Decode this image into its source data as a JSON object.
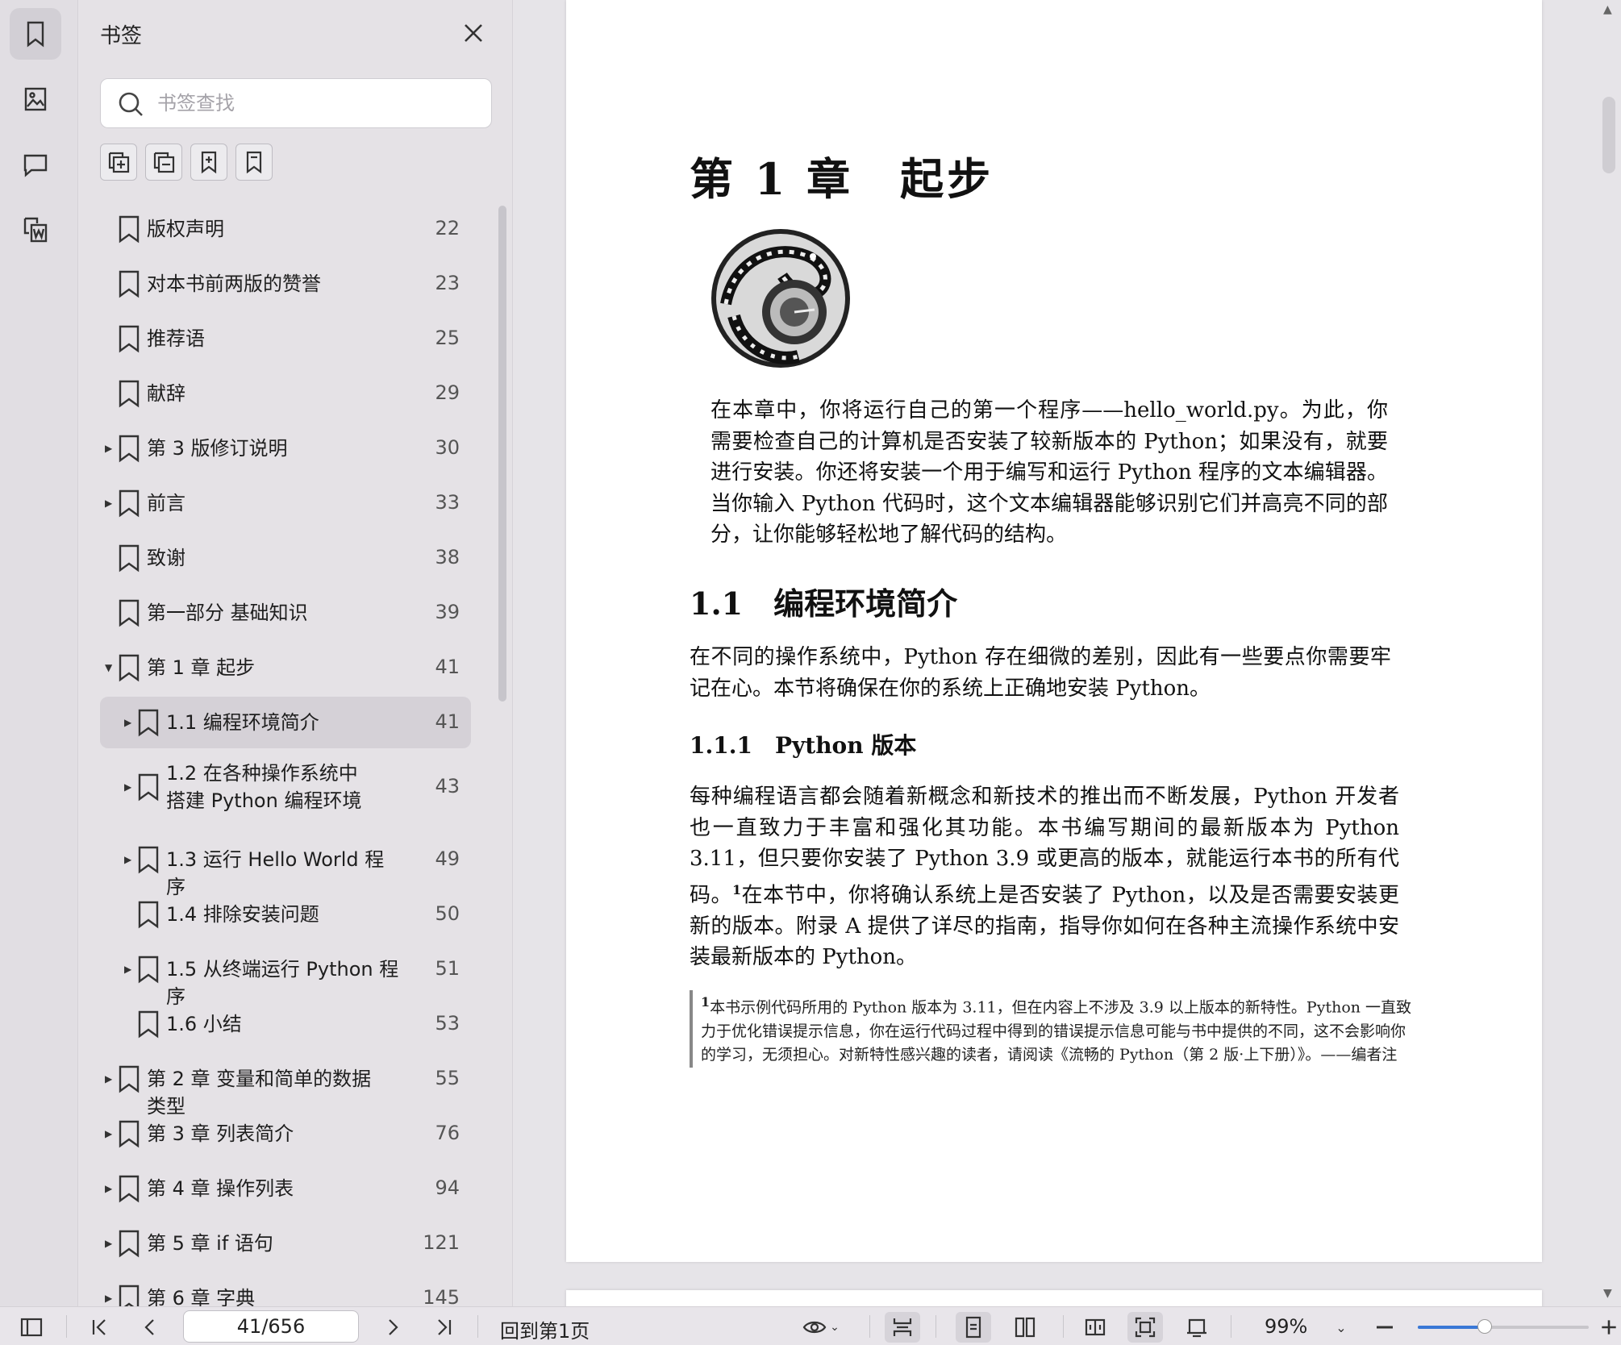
{
  "rail": {
    "items": [
      "bookmark-icon",
      "image-icon",
      "comment-icon",
      "convert-word-icon"
    ]
  },
  "panel": {
    "title": "书签",
    "search_placeholder": "书签查找",
    "tools": [
      "expand-all-icon",
      "collapse-all-icon",
      "add-bookmark-icon",
      "bookmark-outline-icon"
    ],
    "items": [
      {
        "label": "版权声明",
        "page": "22",
        "level": 0,
        "arrow": ""
      },
      {
        "label": "对本书前两版的赞誉",
        "page": "23",
        "level": 0,
        "arrow": ""
      },
      {
        "label": "推荐语",
        "page": "25",
        "level": 0,
        "arrow": ""
      },
      {
        "label": "献辞",
        "page": "29",
        "level": 0,
        "arrow": ""
      },
      {
        "label": "第 3 版修订说明",
        "page": "30",
        "level": 0,
        "arrow": "right"
      },
      {
        "label": "前言",
        "page": "33",
        "level": 0,
        "arrow": "right"
      },
      {
        "label": "致谢",
        "page": "38",
        "level": 0,
        "arrow": ""
      },
      {
        "label": "第一部分 基础知识",
        "page": "39",
        "level": 0,
        "arrow": ""
      },
      {
        "label": "第 1 章 起步",
        "page": "41",
        "level": 0,
        "arrow": "down"
      },
      {
        "label": "1.1 编程环境简介",
        "page": "41",
        "level": 1,
        "arrow": "right",
        "selected": true
      },
      {
        "label": "1.2 在各种操作系统中搭建 Python 编程环境",
        "page": "43",
        "level": 1,
        "arrow": "right",
        "double": true
      },
      {
        "label": "1.3 运行 Hello World 程序",
        "page": "49",
        "level": 1,
        "arrow": "right"
      },
      {
        "label": "1.4 排除安装问题",
        "page": "50",
        "level": 1,
        "arrow": ""
      },
      {
        "label": "1.5 从终端运行 Python 程序",
        "page": "51",
        "level": 1,
        "arrow": "right"
      },
      {
        "label": "1.6 小结",
        "page": "53",
        "level": 1,
        "arrow": ""
      },
      {
        "label": "第 2 章 变量和简单的数据类型",
        "page": "55",
        "level": 0,
        "arrow": "right"
      },
      {
        "label": "第 3 章 列表简介",
        "page": "76",
        "level": 0,
        "arrow": "right"
      },
      {
        "label": "第 4 章 操作列表",
        "page": "94",
        "level": 0,
        "arrow": "right"
      },
      {
        "label": "第 5 章 if 语句",
        "page": "121",
        "level": 0,
        "arrow": "right"
      },
      {
        "label": "第 6 章 字典",
        "page": "145",
        "level": 0,
        "arrow": "right"
      }
    ]
  },
  "document": {
    "chapter_title": "第 1 章　起步",
    "intro": "在本章中，你将运行自己的第一个程序——hello_world.py。为此，你需要检查自己的计算机是否安装了较新版本的 Python；如果没有，就要进行安装。你还将安装一个用于编写和运行 Python 程序的文本编辑器。当你输入 Python 代码时，这个文本编辑器能够识别它们并高亮不同的部分，让你能够轻松地了解代码的结构。",
    "h_1_1": "1.1　编程环境简介",
    "p_1_1": "在不同的操作系统中，Python 存在细微的差别，因此有一些要点你需要牢记在心。本节将确保在你的系统上正确地安装 Python。",
    "h_1_1_1": "1.1.1　Python 版本",
    "p_1_1_1a": "每种编程语言都会随着新概念和新技术的推出而不断发展，Python 开发者也一直致力于丰富和强化其功能。本书编写期间的最新版本为 Python 3.11，但只要你安装了 Python 3.9 或更高的版本，就能运行本书的所有代码。",
    "footnote_mark": "1",
    "p_1_1_1b": "在本节中，你将确认系统上是否安装了 Python，以及是否需要安装更新的版本。附录 A 提供了详尽的指南，指导你如何在各种主流操作系统中安装最新版本的 Python。",
    "footnote": "本书示例代码所用的 Python 版本为 3.11，但在内容上不涉及 3.9 以上版本的新特性。Python 一直致力于优化错误提示信息，你在运行代码过程中得到的错误提示信息可能与书中提供的不同，这不会影响你的学习，无须担心。对新特性感兴趣的读者，请阅读《流畅的 Python（第 2 版·上下册）》。——编者注"
  },
  "statusbar": {
    "page_value": "41/656",
    "goto_first": "回到第1页",
    "zoom": "99%",
    "zoom_fraction": 0.39
  },
  "colors": {
    "accent": "#3a78d6",
    "panel_bg": "#e5e2e6",
    "selected_bg": "#d5d1d7"
  }
}
